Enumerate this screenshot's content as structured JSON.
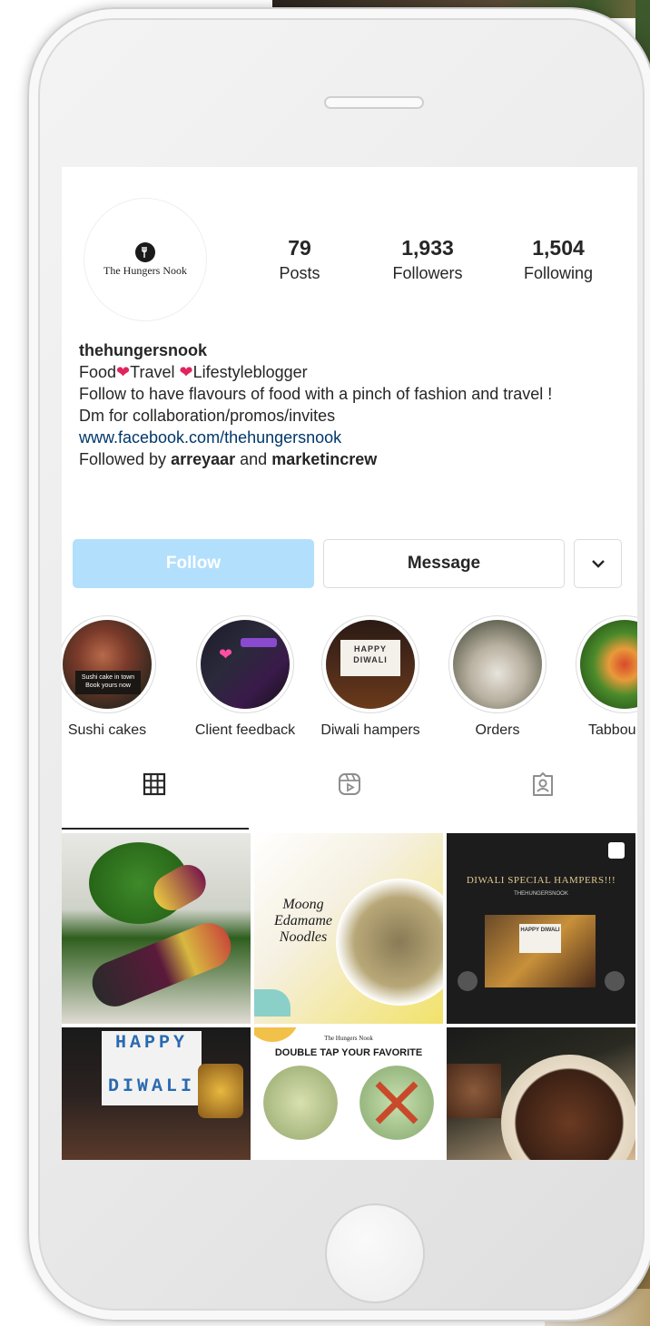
{
  "profile": {
    "avatar_text": "The Hungers Nook",
    "posts_count": "79",
    "posts_label": "Posts",
    "followers_count": "1,933",
    "followers_label": "Followers",
    "following_count": "1,504",
    "following_label": "Following"
  },
  "bio": {
    "username": "thehungersnook",
    "line1_part1": "Food",
    "line1_part2": "Travel ",
    "line1_part3": "Lifestyleblogger",
    "line2": "Follow to have flavours of food with a pinch of fashion and travel !",
    "line3": "Dm for collaboration/promos/invites",
    "link": "www.facebook.com/thehungersnook",
    "followed_prefix": "Followed by ",
    "followed_user1": "arreyaar",
    "followed_and": " and ",
    "followed_user2": "marketincrew"
  },
  "actions": {
    "follow": "Follow",
    "message": "Message",
    "more": "⌄"
  },
  "highlights": [
    {
      "label": "Sushi cakes",
      "overlay": "Sushi cake in town\nBook yours now"
    },
    {
      "label": "Client feedback"
    },
    {
      "label": "Diwali hampers",
      "overlay": "HAPPY DIWALI"
    },
    {
      "label": "Orders"
    },
    {
      "label": "Tabbou"
    }
  ],
  "tabs": [
    "grid-icon",
    "reels-icon",
    "tagged-icon"
  ],
  "posts": [
    {
      "text": ""
    },
    {
      "text": "Moong Edamame Noodles"
    },
    {
      "text": "DIWALI SPECIAL HAMPERS!!!",
      "subtext": "THEHUNGERSNOOK",
      "card": "HAPPY DIWALI"
    },
    {
      "text": "HAPPY",
      "text2": "DIWALI"
    },
    {
      "text": "DOUBLE TAP YOUR FAVORITE",
      "brand": "The Hungers Nook"
    },
    {
      "text": ""
    }
  ],
  "colors": {
    "follow_button": "#b2dffc",
    "link": "#00376b",
    "heart": "#e0245e"
  }
}
